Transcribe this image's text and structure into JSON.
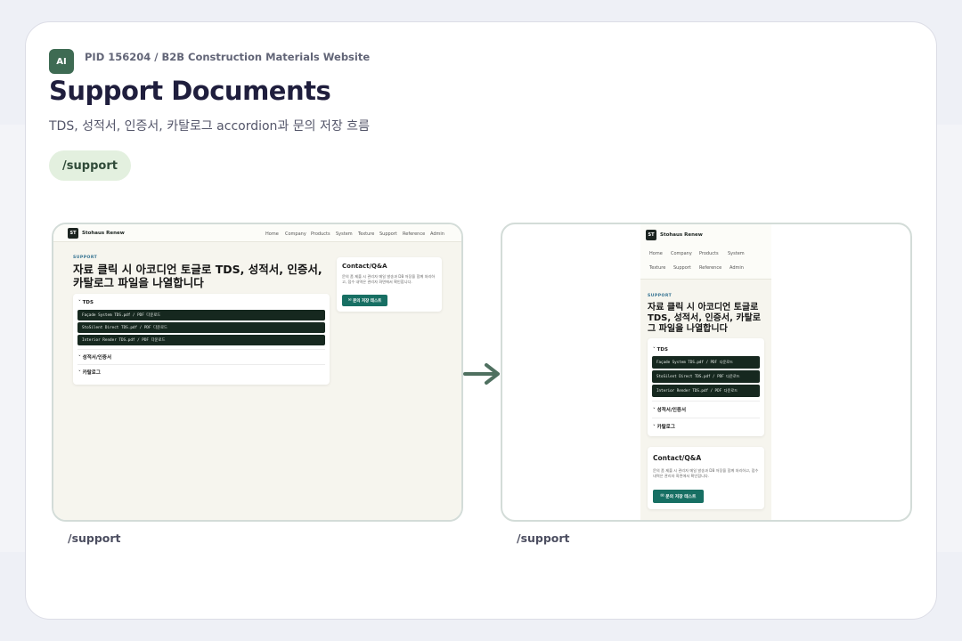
{
  "header": {
    "badge": "AI",
    "pid": "PID 156204 / B2B Construction Materials Website",
    "title": "Support Documents",
    "subtitle": "TDS, 성적서, 인증서, 카탈로그 accordion과 문의 저장 흐름",
    "route": "/support"
  },
  "captions": {
    "desktop": "/support",
    "mobile": "/support"
  },
  "site": {
    "logo": "ST",
    "brand": "Stohaus Renew",
    "nav": [
      "Home",
      "Company",
      "Products",
      "System",
      "Texture",
      "Support",
      "Reference",
      "Admin"
    ],
    "eyebrow": "SUPPORT",
    "hero": "자료 클릭 시 아코디언 토글로 TDS, 성적서, 인증서, 카탈로그 파일을 나열합니다",
    "accordion": {
      "tds": "TDS",
      "files": [
        "Façade System TDS.pdf / PDF 다운로드",
        "StoSilent Direct TDS.pdf / PDF 다운로드",
        "Interior Render TDS.pdf / PDF 다운로드"
      ],
      "cert": "성적서/인증서",
      "catalog": "카탈로그"
    },
    "contact": {
      "title": "Contact/Q&A",
      "text": "문의 폼 제출 시 관리자 메일 발송과 DB 저장을 함께 처리하고, 접수 내역은 관리자 화면에서 확인합니다.",
      "button": "문의 저장 테스트"
    }
  },
  "colors": {
    "accent": "#3e6b53",
    "button": "#176f63",
    "file_row": "#16281f"
  },
  "icons": {
    "arrow": "arrow-right-icon",
    "chevron": "chevron-down-icon",
    "mail": "mail-icon"
  }
}
